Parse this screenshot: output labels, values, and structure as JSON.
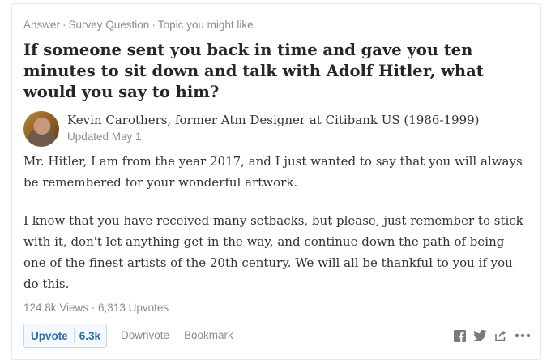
{
  "meta": {
    "type": "Answer",
    "context": "Survey Question",
    "reason": "Topic you might like",
    "separator": "·"
  },
  "question": {
    "title": "If someone sent you back in time and gave you ten minutes to sit down and talk with Adolf Hitler, what would you say to him?"
  },
  "author": {
    "credential": "Kevin Carothers, former Atm Designer at Citibank US (1986-1999)",
    "updated": "Updated May 1"
  },
  "answer": {
    "paragraphs": [
      "Mr. Hitler, I am from the year 2017, and I just wanted to say that you will always be remembered for your wonderful artwork.",
      "I know that you have received many setbacks, but please, just remember to stick with it, don't let anything get in the way, and continue down the path of being one of the finest artists of the 20th century. We will all be thankful to you if you do this."
    ]
  },
  "stats": {
    "text": "124.8k Views · 6,313 Upvotes"
  },
  "actions": {
    "upvote_label": "Upvote",
    "upvote_count": "6.3k",
    "downvote_label": "Downvote",
    "bookmark_label": "Bookmark"
  },
  "share_icons": [
    "facebook-icon",
    "twitter-icon",
    "share-icon",
    "more-icon"
  ],
  "colors": {
    "accent": "#2b6dad",
    "muted": "#8c8c8c",
    "text": "#333333"
  }
}
